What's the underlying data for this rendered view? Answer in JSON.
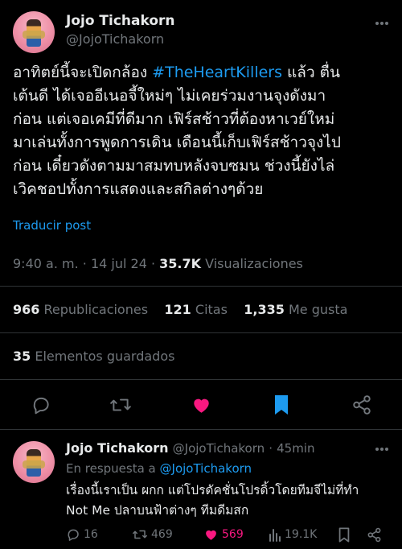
{
  "tweet": {
    "author_name": "Jojo Tichakorn",
    "author_handle": "@JojoTichakorn",
    "text_line1_pre": "อาทิตย์นี้จะเปิดกล้อง ",
    "hashtag": "#TheHeartKillers",
    "text_line1_post": " แล้ว ตื่น",
    "text_rest": "เต้นดี ได้เจออีเนอจี้ใหม่ๆ ไม่เคยร่วมงานจุงดังมา\nก่อน แต่เจอเคมีที่ดีมาก เฟิร์สช้าวที่ต้องหาเวย์ใหม่\nมาเล่นทั้งการพูดการเดิน เดือนนี้เก็บเฟิร์สช้าวจุงไป\nก่อน เดี๋ยวดังตามมาสมทบหลังจบซมน ช่วงนี้ยังไล่\nเวิคชอปทั้งการแสดงและสกิลต่างๆด้วย",
    "translate_label": "Traducir post",
    "time": "9:40 a. m.",
    "date": "14 jul 24",
    "views_count": "35.7K",
    "views_label": "Visualizaciones",
    "sep": "·"
  },
  "stats": {
    "reposts_count": "966",
    "reposts_label": "Republicaciones",
    "quotes_count": "121",
    "quotes_label": "Citas",
    "likes_count": "1,335",
    "likes_label": "Me gusta",
    "bookmarks_count": "35",
    "bookmarks_label": "Elementos guardados"
  },
  "colors": {
    "accent": "#1d9bf0",
    "like": "#f91880",
    "muted": "#71767b",
    "text": "#e7e9ea",
    "divider": "#2f3336"
  },
  "reply": {
    "author_name": "Jojo Tichakorn",
    "author_handle": "@JojoTichakorn",
    "sep": "·",
    "time": "45min",
    "reply_to_prefix": "En respuesta a",
    "reply_to_handle": "@JojoTichakorn",
    "text": "เรื่องนี้เราเป็น ผกก แต่โปรดัคชั่นโปรดิ้วโดยทีมจีไม่ที่ทำ\nNot Me ปลาบนฟ้าต่างๆ ทีมดีมสก",
    "replies_count": "16",
    "reposts_count": "469",
    "likes_count": "569",
    "views_count": "19.1K"
  }
}
